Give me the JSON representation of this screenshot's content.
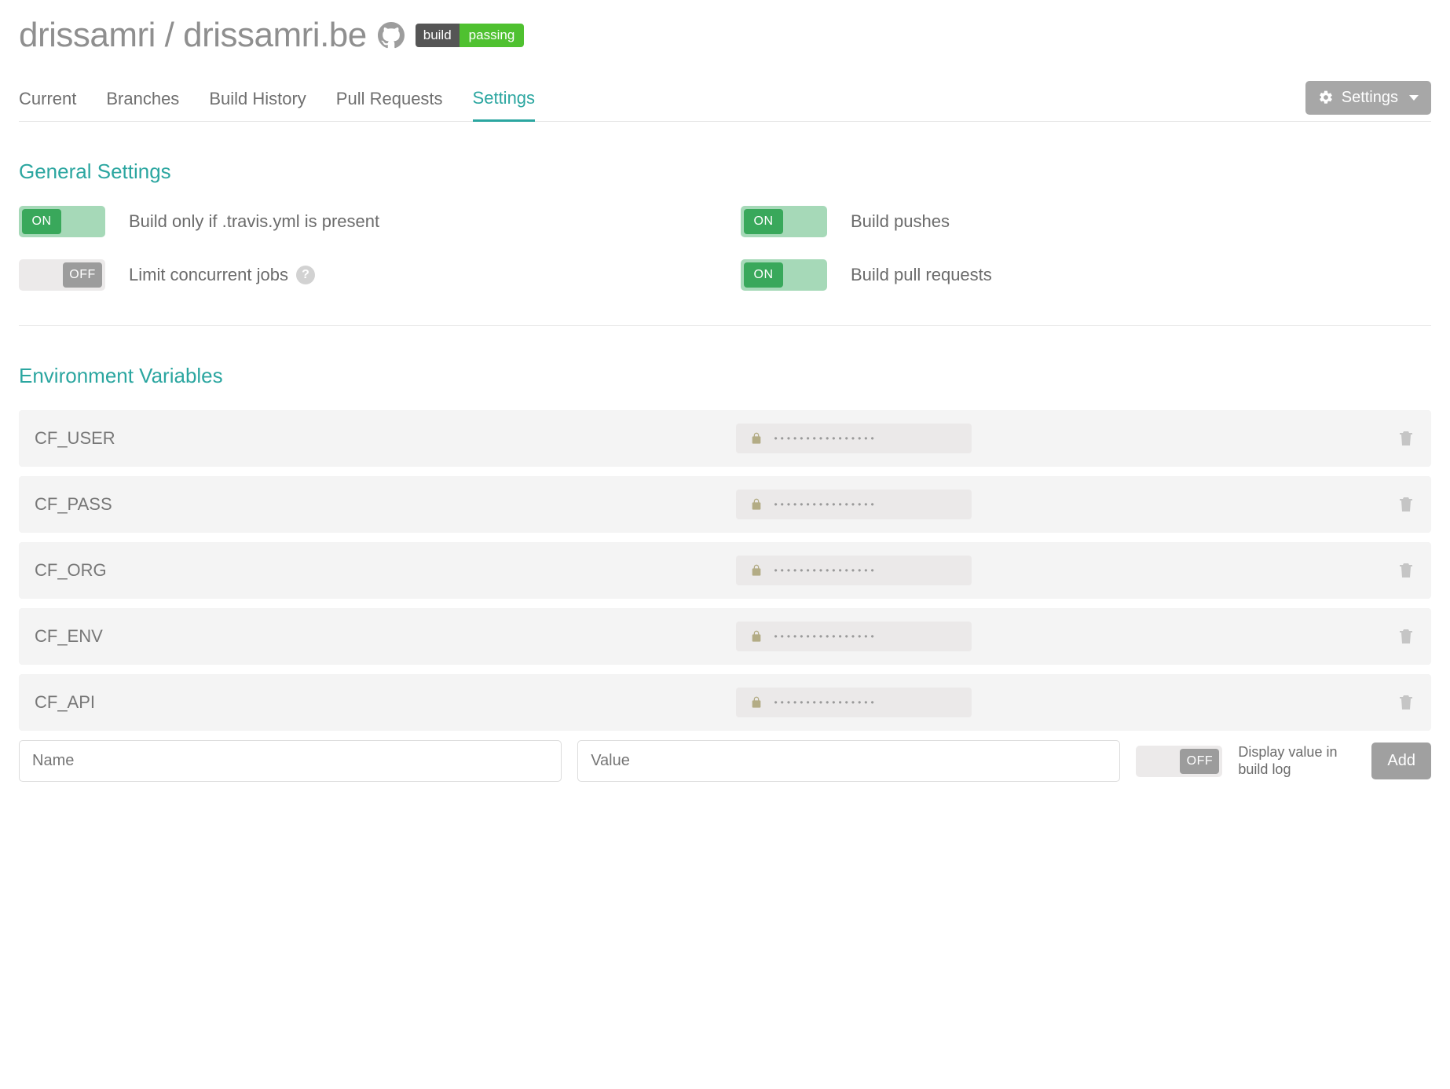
{
  "header": {
    "repo_title": "drissamri / drissamri.be",
    "badge": {
      "left": "build",
      "right": "passing"
    }
  },
  "tabs": [
    {
      "label": "Current",
      "active": false
    },
    {
      "label": "Branches",
      "active": false
    },
    {
      "label": "Build History",
      "active": false
    },
    {
      "label": "Pull Requests",
      "active": false
    },
    {
      "label": "Settings",
      "active": true
    }
  ],
  "settings_dropdown_label": "Settings",
  "toggle_labels": {
    "on": "ON",
    "off": "OFF"
  },
  "general": {
    "title": "General Settings",
    "items": [
      {
        "label": "Build only if .travis.yml is present",
        "state": "on",
        "help": false
      },
      {
        "label": "Build pushes",
        "state": "on",
        "help": false
      },
      {
        "label": "Limit concurrent jobs",
        "state": "off",
        "help": true
      },
      {
        "label": "Build pull requests",
        "state": "on",
        "help": false
      }
    ]
  },
  "env": {
    "title": "Environment Variables",
    "vars": [
      {
        "name": "CF_USER",
        "masked": "••••••••••••••••"
      },
      {
        "name": "CF_PASS",
        "masked": "••••••••••••••••"
      },
      {
        "name": "CF_ORG",
        "masked": "••••••••••••••••"
      },
      {
        "name": "CF_ENV",
        "masked": "••••••••••••••••"
      },
      {
        "name": "CF_API",
        "masked": "••••••••••••••••"
      }
    ],
    "new": {
      "name_placeholder": "Name",
      "value_placeholder": "Value",
      "display_toggle_state": "off",
      "display_label": "Display value in build log",
      "add_label": "Add"
    }
  }
}
